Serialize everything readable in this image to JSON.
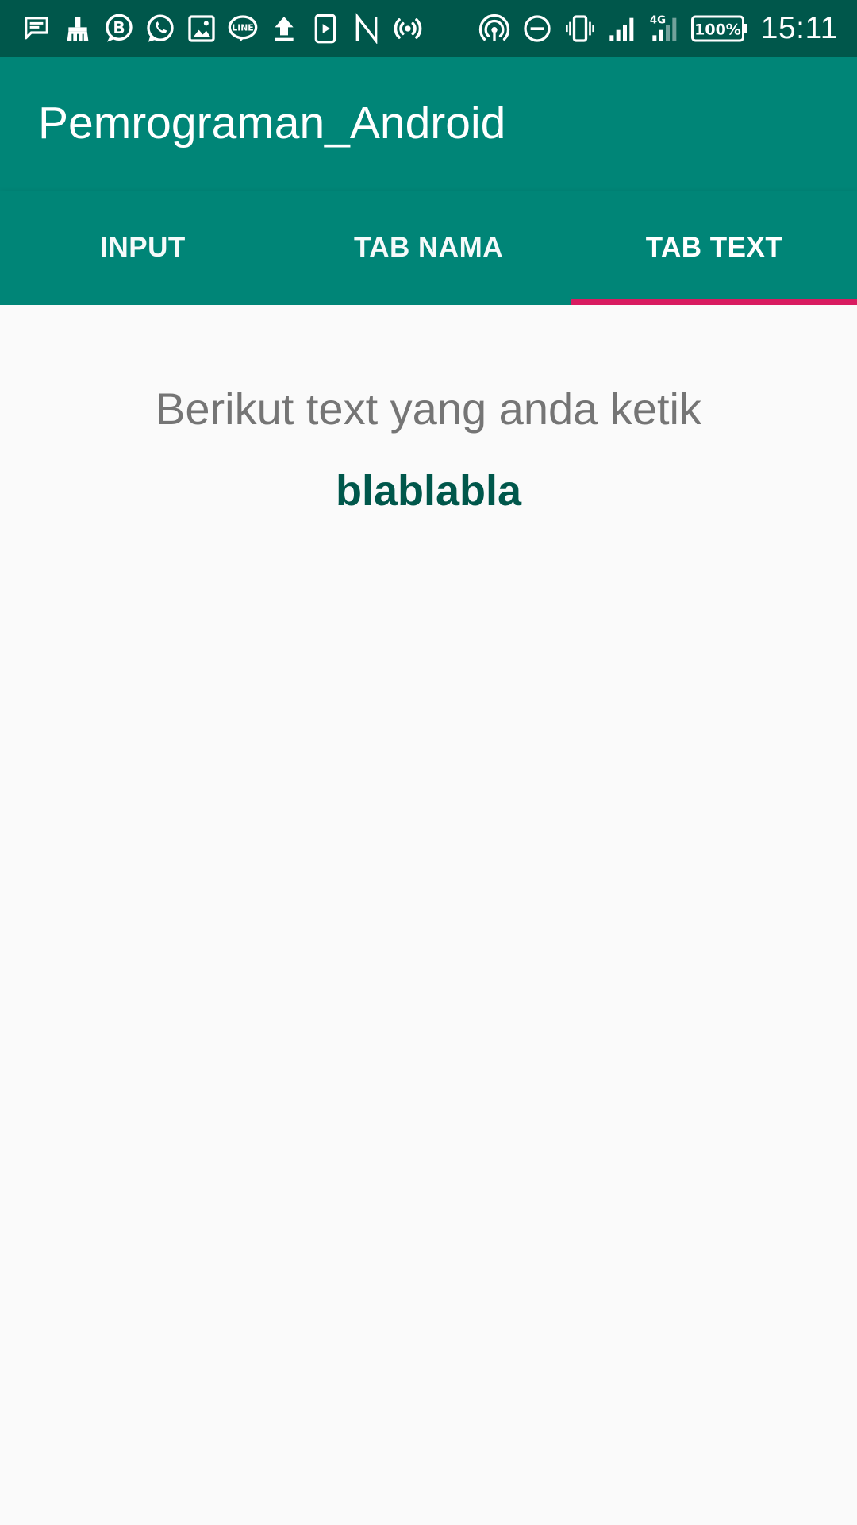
{
  "status_bar": {
    "left_icons": [
      "message-icon",
      "cleaner-icon",
      "bbm-icon",
      "whatsapp-icon",
      "gallery-icon",
      "line-icon",
      "upload-icon",
      "video-icon",
      "n-icon",
      "broadcast-icon"
    ],
    "right_icons": [
      "hotspot-icon",
      "do-not-disturb-icon",
      "vibrate-icon",
      "signal-icon",
      "signal-4g-icon"
    ],
    "network_label": "4G",
    "battery_label": "100%",
    "time": "15:11"
  },
  "app_bar": {
    "title": "Pemrograman_Android"
  },
  "tabs": [
    {
      "label": "INPUT",
      "selected": false
    },
    {
      "label": "TAB NAMA",
      "selected": false
    },
    {
      "label": "TAB TEXT",
      "selected": true
    }
  ],
  "content": {
    "prompt": "Berikut text yang anda ketik",
    "typed_value": "blablabla"
  },
  "colors": {
    "status_bar": "#00574b",
    "primary": "#008577",
    "accent": "#d81b60",
    "background": "#fafafa",
    "typed_text": "#00574b",
    "prompt_text": "#757575"
  }
}
